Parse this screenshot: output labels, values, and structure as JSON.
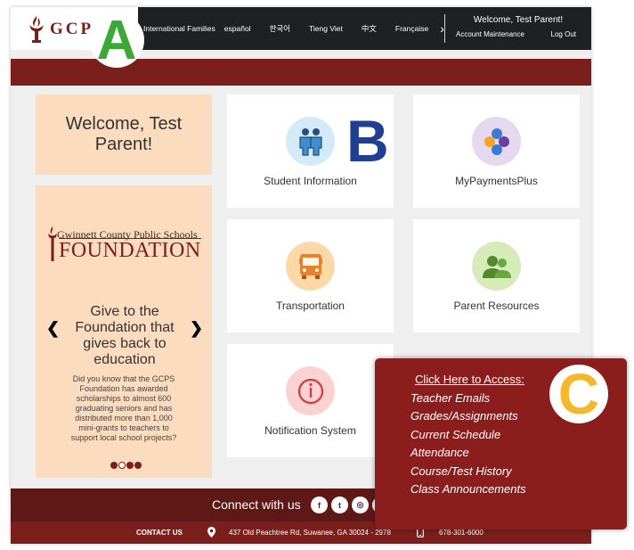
{
  "header": {
    "logo_text": "GCPS",
    "languages": [
      "International Families",
      "español",
      "한국어",
      "Tieng Viet",
      "中文",
      "Française"
    ],
    "lang_next_glyph": "›",
    "welcome": "Welcome, Test Parent!",
    "account_maintenance": "Account Maintenance",
    "log_out": "Log Out"
  },
  "welcome_card": {
    "text": "Welcome, Test Parent!"
  },
  "foundation": {
    "logo_line1": "Gwinnett County Public Schools",
    "logo_line2": "FOUNDATION",
    "title": "Give to the Foundation that gives back to education",
    "body": "Did you know that the GCPS Foundation has awarded scholarships to almost 600 graduating seniors and has distributed more than 1,000 mini-grants to teachers to support local school projects?",
    "prev_glyph": "❮",
    "next_glyph": "❯",
    "slide_count": 4,
    "active_slide": 2
  },
  "tiles": [
    {
      "label": "Student Information",
      "icon": "students-icon",
      "bg": "#d3ebf8"
    },
    {
      "label": "MyPaymentsPlus",
      "icon": "payments-icon",
      "bg": "#e6d8ee"
    },
    {
      "label": "Transportation",
      "icon": "bus-icon",
      "bg": "#fdd9a8"
    },
    {
      "label": "Parent Resources",
      "icon": "parents-icon",
      "bg": "#d6ebb8"
    },
    {
      "label": "Notification System",
      "icon": "alert-icon",
      "bg": "#fad2d2"
    }
  ],
  "markers": {
    "a": "A",
    "b": "B",
    "c": "C"
  },
  "footer": {
    "connect": "Connect with us",
    "social": [
      "f",
      "t",
      "◎",
      ""
    ],
    "contact_label": "CONTACT US",
    "address": "437 Old Peachtree Rd, Suwanee, GA 30024 - 2978",
    "phone": "678-301-6000"
  },
  "popup": {
    "heading": "Click Here to Access:",
    "items": [
      "Teacher Emails",
      "Grades/Assignments",
      "Current Schedule",
      "Attendance",
      "Course/Test History",
      "Class Announcements"
    ]
  },
  "colors": {
    "maroon": "#7b1f1c",
    "popup": "#8b1e1c",
    "header": "#1f2024",
    "peach": "#fbdcbf",
    "marker_a": "#3aa935",
    "marker_b": "#1f3f91",
    "marker_c": "#f4b82a"
  }
}
